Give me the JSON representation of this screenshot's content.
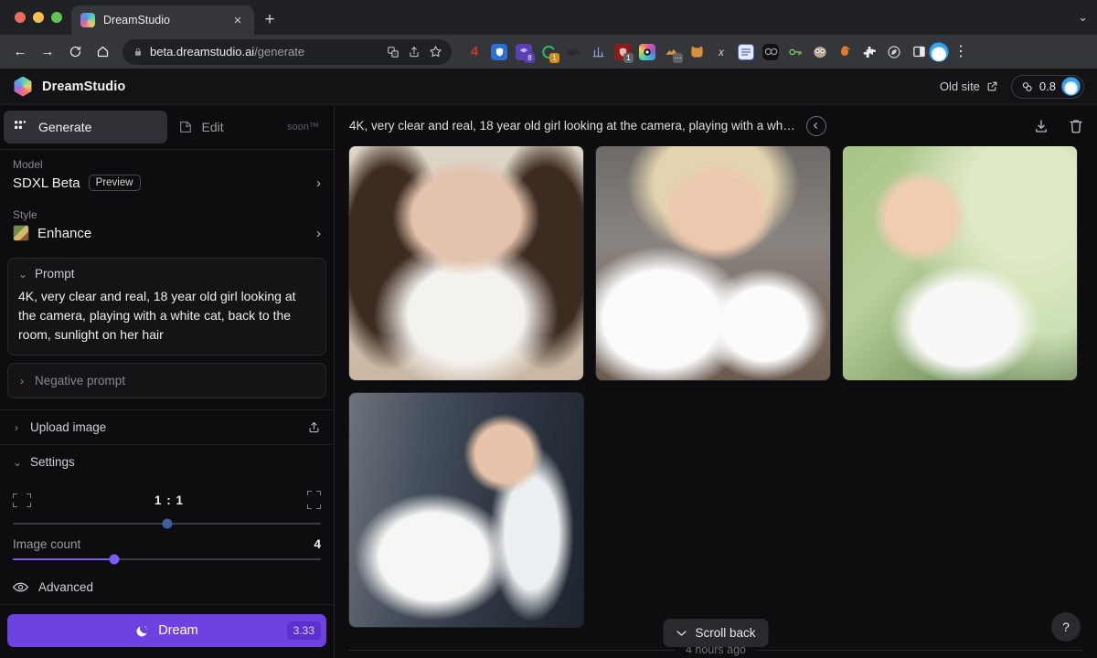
{
  "browser": {
    "tab": {
      "title": "DreamStudio",
      "favicon": "dreamstudio-favicon",
      "close": "×"
    },
    "new_tab_label": "+",
    "nav": {
      "back": "←",
      "forward": "→",
      "reload": "↻",
      "home": "⌂"
    },
    "omnibox": {
      "lock": "🔒",
      "domain": "beta.dreamstudio.ai",
      "path": "/generate"
    },
    "kebab": "⋮",
    "tabstrip_chevron": "⌄"
  },
  "app": {
    "brand": "DreamStudio",
    "old_site_label": "Old site",
    "credits": "0.8"
  },
  "sidebar": {
    "modes": [
      {
        "label": "Generate",
        "icon": "grid-icon",
        "active": true,
        "badge": ""
      },
      {
        "label": "Edit",
        "icon": "pencil-square-icon",
        "active": false,
        "badge": "soon™"
      }
    ],
    "model": {
      "label": "Model",
      "value": "SDXL Beta",
      "tag": "Preview",
      "chevron": "›"
    },
    "style": {
      "label": "Style",
      "value": "Enhance",
      "chevron": "›"
    },
    "prompt": {
      "label": "Prompt",
      "chevron": "⌄",
      "value": "4K, very clear and real, 18 year old girl looking at the camera, playing with a white cat, back to the room, sunlight on her hair"
    },
    "negative_prompt": {
      "label": "Negative prompt",
      "chevron": "›"
    },
    "upload_image": {
      "label": "Upload image",
      "chevron": "›",
      "icon": "upload-icon"
    },
    "settings": {
      "label": "Settings",
      "chevron": "⌄",
      "aspect_ratio": {
        "value": "1 : 1",
        "left_icon": "landscape-frame-icon",
        "right_icon": "portrait-frame-icon",
        "knob_percent": 50
      },
      "image_count": {
        "label": "Image count",
        "value": "4",
        "fill_percent": 33
      }
    },
    "advanced": {
      "label": "Advanced",
      "icon": "eye-icon"
    },
    "dream_button": {
      "label": "Dream",
      "icon": "moon-icon",
      "cost": "3.33"
    }
  },
  "main": {
    "prompt_title": "4K, very clear and real, 18 year old girl looking at the camera, playing with a wh…",
    "collapse_icon": "‹",
    "download_icon": "download-icon",
    "delete_icon": "trash-icon",
    "images": [
      {
        "alt": "brunette girl holding white cat, beige background",
        "class": "ph1"
      },
      {
        "alt": "blonde girl holding two white cats, grey background",
        "class": "ph2"
      },
      {
        "alt": "blonde girl holding white cat, green outdoor bokeh",
        "class": "ph3"
      },
      {
        "alt": "brunette girl in white shirt holding fluffy white cat, blue room",
        "class": "ph4"
      }
    ],
    "scroll_back": {
      "label": "Scroll back",
      "chevron": "⌄"
    },
    "timestamp": "4 hours ago",
    "help_label": "?"
  },
  "colors": {
    "accent_violet": "#6d42e0",
    "slider_violet": "#7c5cf0",
    "slider_blue": "#3f5c9c",
    "app_bg": "#0d0d0f",
    "panel_bg": "#141417"
  }
}
